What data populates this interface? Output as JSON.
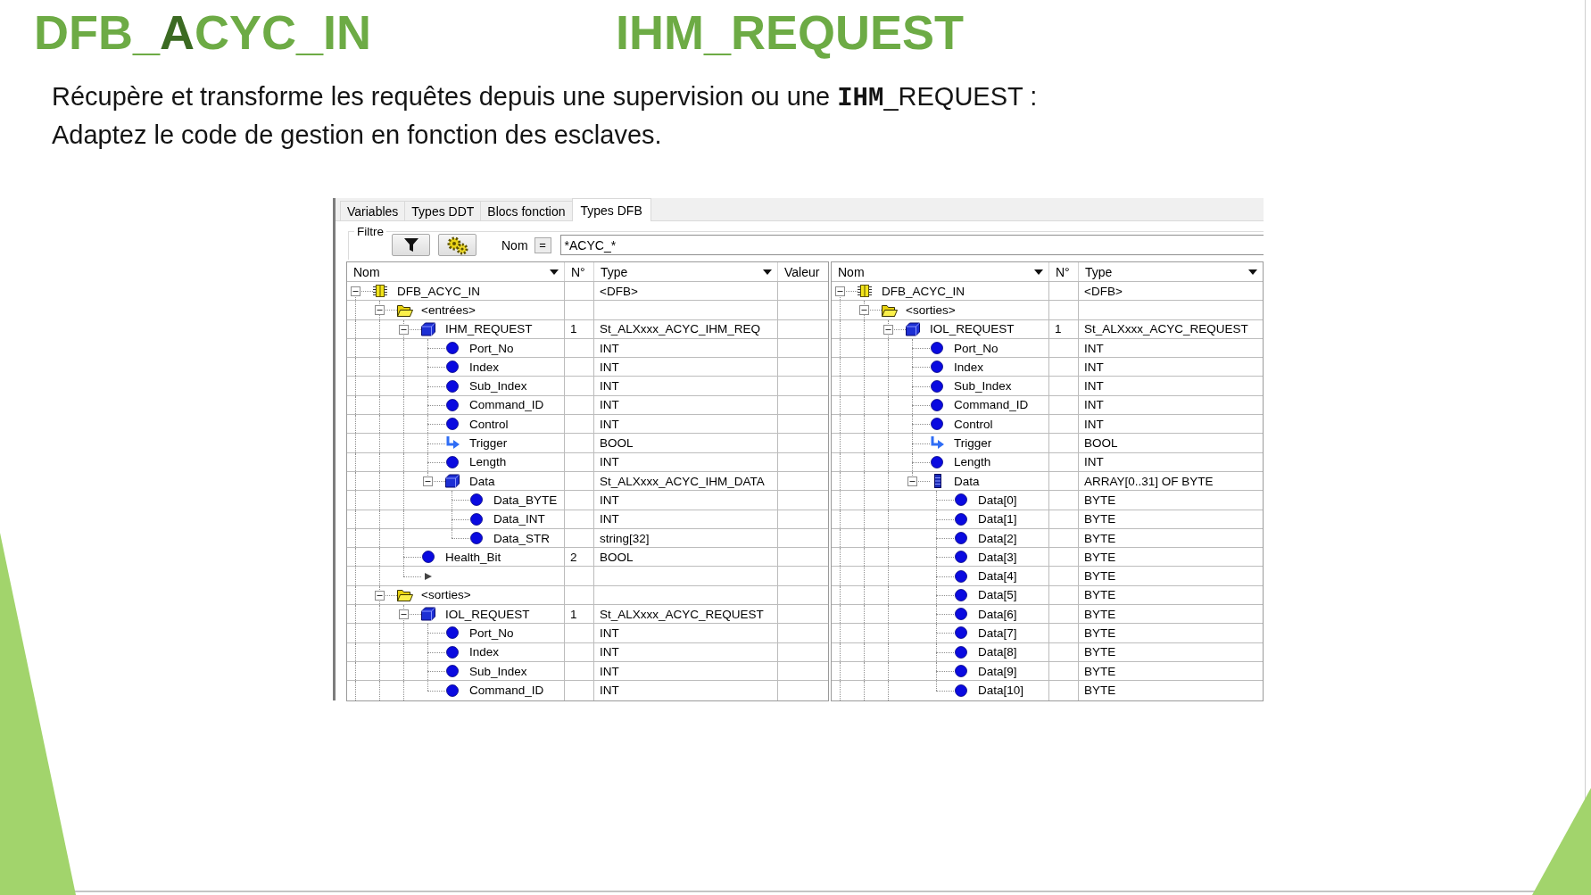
{
  "titles": [
    {
      "segments": [
        {
          "text": "DFB_",
          "accent": false
        },
        {
          "text": "A",
          "accent": true
        },
        {
          "text": "CYC_IN",
          "accent": false
        }
      ]
    },
    {
      "segments": [
        {
          "text": "IHM_REQUEST",
          "accent": false
        }
      ]
    }
  ],
  "intro": [
    "Récupère et transforme les requêtes depuis une supervision ou une **IHM**_REQUEST :",
    "Adaptez le code de gestion en fonction des esclaves."
  ],
  "editor": {
    "tabs": [
      {
        "label": "Variables",
        "selected": false
      },
      {
        "label": "Types DDT",
        "selected": false
      },
      {
        "label": "Blocs fonction",
        "selected": false
      },
      {
        "label": "Types DFB",
        "selected": true
      }
    ],
    "filter": {
      "group_label": "Filtre",
      "name_label": "Nom",
      "operator": "=",
      "value": "*ACYC_*"
    },
    "panes": [
      {
        "columns": [
          {
            "kind": "name",
            "label": "Nom",
            "dropdown": true
          },
          {
            "kind": "number",
            "label": "N°",
            "dropdown": false
          },
          {
            "kind": "type",
            "label": "Type",
            "dropdown": true
          },
          {
            "kind": "value",
            "label": "Valeur",
            "dropdown": false
          }
        ],
        "rows": [
          {
            "kind": "dfb",
            "name": "DFB_ACYC_IN",
            "type": "<DFB>",
            "expanded": true,
            "children": [
              {
                "kind": "folder",
                "name": "<entrées>",
                "expanded": true,
                "children": [
                  {
                    "kind": "struct",
                    "name": "IHM_REQUEST",
                    "number": "1",
                    "type": "St_ALXxxx_ACYC_IHM_REQ",
                    "expanded": true,
                    "children": [
                      {
                        "kind": "variable",
                        "name": "Port_No",
                        "type": "INT"
                      },
                      {
                        "kind": "variable",
                        "name": "Index",
                        "type": "INT"
                      },
                      {
                        "kind": "variable",
                        "name": "Sub_Index",
                        "type": "INT"
                      },
                      {
                        "kind": "variable",
                        "name": "Command_ID",
                        "type": "INT"
                      },
                      {
                        "kind": "variable",
                        "name": "Control",
                        "type": "INT"
                      },
                      {
                        "kind": "trigger",
                        "name": "Trigger",
                        "type": "BOOL"
                      },
                      {
                        "kind": "variable",
                        "name": "Length",
                        "type": "INT"
                      },
                      {
                        "kind": "struct",
                        "name": "Data",
                        "type": "St_ALXxxx_ACYC_IHM_DATA",
                        "expanded": true,
                        "children": [
                          {
                            "kind": "variable",
                            "name": "Data_BYTE",
                            "type": "INT"
                          },
                          {
                            "kind": "variable",
                            "name": "Data_INT",
                            "type": "INT"
                          },
                          {
                            "kind": "variable",
                            "name": "Data_STR",
                            "type": "string[32]"
                          }
                        ]
                      }
                    ]
                  },
                  {
                    "kind": "variable",
                    "name": "Health_Bit",
                    "number": "2",
                    "type": "BOOL"
                  },
                  {
                    "kind": "new_row"
                  }
                ]
              },
              {
                "kind": "folder",
                "name": "<sorties>",
                "expanded": true,
                "children": [
                  {
                    "kind": "struct",
                    "name": "IOL_REQUEST",
                    "number": "1",
                    "type": "St_ALXxxx_ACYC_REQUEST",
                    "expanded": true,
                    "children": [
                      {
                        "kind": "variable",
                        "name": "Port_No",
                        "type": "INT"
                      },
                      {
                        "kind": "variable",
                        "name": "Index",
                        "type": "INT"
                      },
                      {
                        "kind": "variable",
                        "name": "Sub_Index",
                        "type": "INT"
                      },
                      {
                        "kind": "variable",
                        "name": "Command_ID",
                        "type": "INT"
                      }
                    ]
                  }
                ]
              }
            ]
          }
        ]
      },
      {
        "columns": [
          {
            "kind": "name",
            "label": "Nom",
            "dropdown": true
          },
          {
            "kind": "number",
            "label": "N°",
            "dropdown": false
          },
          {
            "kind": "type",
            "label": "Type",
            "dropdown": true
          }
        ],
        "rows": [
          {
            "kind": "dfb",
            "name": "DFB_ACYC_IN",
            "type": "<DFB>",
            "expanded": true,
            "children": [
              {
                "kind": "folder",
                "name": "<sorties>",
                "expanded": true,
                "children": [
                  {
                    "kind": "struct",
                    "name": "IOL_REQUEST",
                    "number": "1",
                    "type": "St_ALXxxx_ACYC_REQUEST",
                    "expanded": true,
                    "children": [
                      {
                        "kind": "variable",
                        "name": "Port_No",
                        "type": "INT"
                      },
                      {
                        "kind": "variable",
                        "name": "Index",
                        "type": "INT"
                      },
                      {
                        "kind": "variable",
                        "name": "Sub_Index",
                        "type": "INT"
                      },
                      {
                        "kind": "variable",
                        "name": "Command_ID",
                        "type": "INT"
                      },
                      {
                        "kind": "variable",
                        "name": "Control",
                        "type": "INT"
                      },
                      {
                        "kind": "trigger",
                        "name": "Trigger",
                        "type": "BOOL"
                      },
                      {
                        "kind": "variable",
                        "name": "Length",
                        "type": "INT"
                      },
                      {
                        "kind": "array",
                        "name": "Data",
                        "type": "ARRAY[0..31] OF BYTE",
                        "expanded": true,
                        "children": [
                          {
                            "kind": "variable",
                            "name": "Data[0]",
                            "type": "BYTE"
                          },
                          {
                            "kind": "variable",
                            "name": "Data[1]",
                            "type": "BYTE"
                          },
                          {
                            "kind": "variable",
                            "name": "Data[2]",
                            "type": "BYTE"
                          },
                          {
                            "kind": "variable",
                            "name": "Data[3]",
                            "type": "BYTE"
                          },
                          {
                            "kind": "variable",
                            "name": "Data[4]",
                            "type": "BYTE"
                          },
                          {
                            "kind": "variable",
                            "name": "Data[5]",
                            "type": "BYTE"
                          },
                          {
                            "kind": "variable",
                            "name": "Data[6]",
                            "type": "BYTE"
                          },
                          {
                            "kind": "variable",
                            "name": "Data[7]",
                            "type": "BYTE"
                          },
                          {
                            "kind": "variable",
                            "name": "Data[8]",
                            "type": "BYTE"
                          },
                          {
                            "kind": "variable",
                            "name": "Data[9]",
                            "type": "BYTE"
                          },
                          {
                            "kind": "variable",
                            "name": "Data[10]",
                            "type": "BYTE"
                          }
                        ]
                      }
                    ]
                  }
                ]
              }
            ]
          }
        ]
      }
    ]
  }
}
